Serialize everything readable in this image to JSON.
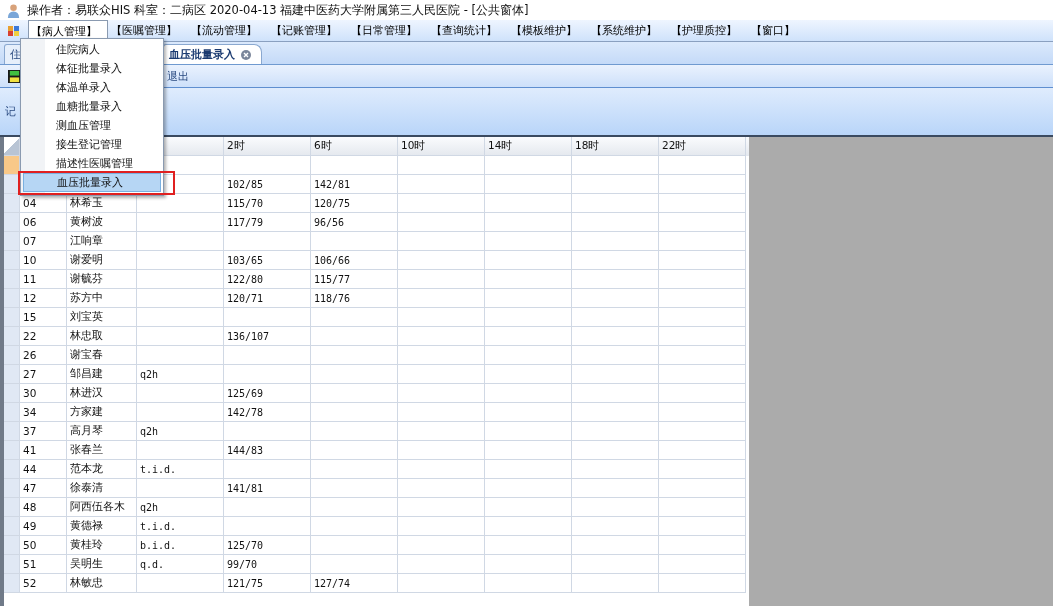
{
  "title_bar": {
    "text": "操作者：易联众HIS  科室：二病区  2020-04-13  福建中医药大学附属第三人民医院 - [公共窗体]"
  },
  "menu_bar": [
    {
      "label": "【病人管理】",
      "selected": true
    },
    {
      "label": "【医嘱管理】",
      "selected": false
    },
    {
      "label": "【流动管理】",
      "selected": false
    },
    {
      "label": "【记账管理】",
      "selected": false
    },
    {
      "label": "【日常管理】",
      "selected": false
    },
    {
      "label": "【查询统计】",
      "selected": false
    },
    {
      "label": "【模板维护】",
      "selected": false
    },
    {
      "label": "【系统维护】",
      "selected": false
    },
    {
      "label": "【护理质控】",
      "selected": false
    },
    {
      "label": "【窗口】",
      "selected": false
    }
  ],
  "dropdown_menu": [
    {
      "label": "住院病人",
      "selected": false
    },
    {
      "label": "体征批量录入",
      "selected": false
    },
    {
      "label": "体温单录入",
      "selected": false
    },
    {
      "label": "血糖批量录入",
      "selected": false
    },
    {
      "label": "测血压管理",
      "selected": false
    },
    {
      "label": "接生登记管理",
      "selected": false
    },
    {
      "label": "描述性医嘱管理",
      "selected": false
    },
    {
      "label": "血压批量录入",
      "selected": true
    }
  ],
  "tabs": [
    {
      "label": "住",
      "selected": false
    },
    {
      "label": "血压批量录入",
      "selected": true,
      "closable": true
    }
  ],
  "toolbar": [
    {
      "kind": "icon"
    },
    {
      "kind": "text",
      "label": "退出"
    }
  ],
  "panel": {
    "label": "记"
  },
  "grid": {
    "columns": [
      {
        "label": "2时"
      },
      {
        "label": "6时"
      },
      {
        "label": "10时"
      },
      {
        "label": "14时"
      },
      {
        "label": "18时"
      },
      {
        "label": "22时"
      }
    ],
    "rows": [
      {
        "selected": true
      },
      {
        "selected": false,
        "values": [
          "102/85",
          "142/81"
        ]
      },
      {
        "selected": false,
        "bed": "04",
        "name": "林希玉",
        "values": [
          "115/70",
          "120/75"
        ]
      },
      {
        "selected": false,
        "bed": "06",
        "name": "黄树波",
        "values": [
          "117/79",
          "96/56"
        ]
      },
      {
        "selected": false,
        "bed": "07",
        "name": "江响章"
      },
      {
        "selected": false,
        "bed": "10",
        "name": "谢爱明",
        "values": [
          "103/65",
          "106/66"
        ]
      },
      {
        "selected": false,
        "bed": "11",
        "name": "谢毓芬",
        "values": [
          "122/80",
          "115/77"
        ]
      },
      {
        "selected": false,
        "bed": "12",
        "name": "苏方中",
        "values": [
          "120/71",
          "118/76"
        ]
      },
      {
        "selected": false,
        "bed": "15",
        "name": "刘宝英"
      },
      {
        "selected": false,
        "bed": "22",
        "name": "林忠取",
        "values": [
          "136/107"
        ]
      },
      {
        "selected": false,
        "bed": "26",
        "name": "谢宝春"
      },
      {
        "selected": false,
        "bed": "27",
        "name": "邹昌建",
        "frequency": "q2h"
      },
      {
        "selected": false,
        "bed": "30",
        "name": "林进汉",
        "values": [
          "125/69"
        ]
      },
      {
        "selected": false,
        "bed": "34",
        "name": "方家建",
        "values": [
          "142/78"
        ]
      },
      {
        "selected": false,
        "bed": "37",
        "name": "高月琴",
        "frequency": "q2h"
      },
      {
        "selected": false,
        "bed": "41",
        "name": "张春兰",
        "values": [
          "144/83"
        ]
      },
      {
        "selected": false,
        "bed": "44",
        "name": "范本龙",
        "frequency": "t.i.d."
      },
      {
        "selected": false,
        "bed": "47",
        "name": "徐泰清",
        "values": [
          "141/81"
        ]
      },
      {
        "selected": false,
        "bed": "48",
        "name": "阿西伍各木",
        "frequency": "q2h"
      },
      {
        "selected": false,
        "bed": "49",
        "name": "黄德禄",
        "frequency": "t.i.d."
      },
      {
        "selected": false,
        "bed": "50",
        "name": "黄桂玲",
        "frequency": "b.i.d.",
        "values": [
          "125/70"
        ]
      },
      {
        "selected": false,
        "bed": "51",
        "name": "吴明生",
        "frequency": "q.d.",
        "values": [
          "99/70"
        ]
      },
      {
        "selected": false,
        "bed": "52",
        "name": "林敏忠",
        "values": [
          "121/75",
          "127/74"
        ]
      }
    ]
  }
}
